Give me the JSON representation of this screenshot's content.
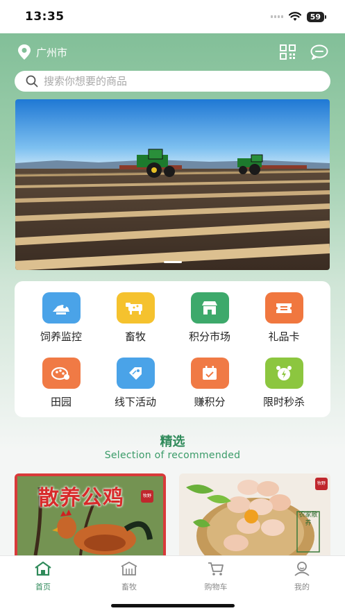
{
  "status": {
    "time": "13:35",
    "battery": "59"
  },
  "header": {
    "location": "广州市"
  },
  "search": {
    "placeholder": "搜索你想要的商品"
  },
  "menu": [
    {
      "label": "饲养监控",
      "icon": "feed-monitor-icon",
      "color": "#4aa3e8"
    },
    {
      "label": "畜牧",
      "icon": "livestock-icon",
      "color": "#f5c22e"
    },
    {
      "label": "积分市场",
      "icon": "points-market-icon",
      "color": "#3da96b"
    },
    {
      "label": "礼品卡",
      "icon": "gift-card-icon",
      "color": "#f0773f"
    },
    {
      "label": "田园",
      "icon": "garden-icon",
      "color": "#f07a45"
    },
    {
      "label": "线下活动",
      "icon": "offline-event-icon",
      "color": "#4aa3e8"
    },
    {
      "label": "赚积分",
      "icon": "earn-points-icon",
      "color": "#f07a45"
    },
    {
      "label": "限时秒杀",
      "icon": "flash-sale-icon",
      "color": "#8cc63f"
    }
  ],
  "section": {
    "title": "精选",
    "subtitle": "Selection of recommended"
  },
  "products": [
    {
      "title": "散养公鸡",
      "tag": "牧野"
    },
    {
      "title": "农家散养",
      "tag": "牧野"
    }
  ],
  "tabbar": [
    {
      "label": "首页",
      "icon": "home-icon",
      "active": true
    },
    {
      "label": "畜牧",
      "icon": "barn-icon",
      "active": false
    },
    {
      "label": "购物车",
      "icon": "cart-icon",
      "active": false
    },
    {
      "label": "我的",
      "icon": "profile-icon",
      "active": false
    }
  ],
  "colors": {
    "brand": "#2f8a5a",
    "header": "#82bf98"
  }
}
